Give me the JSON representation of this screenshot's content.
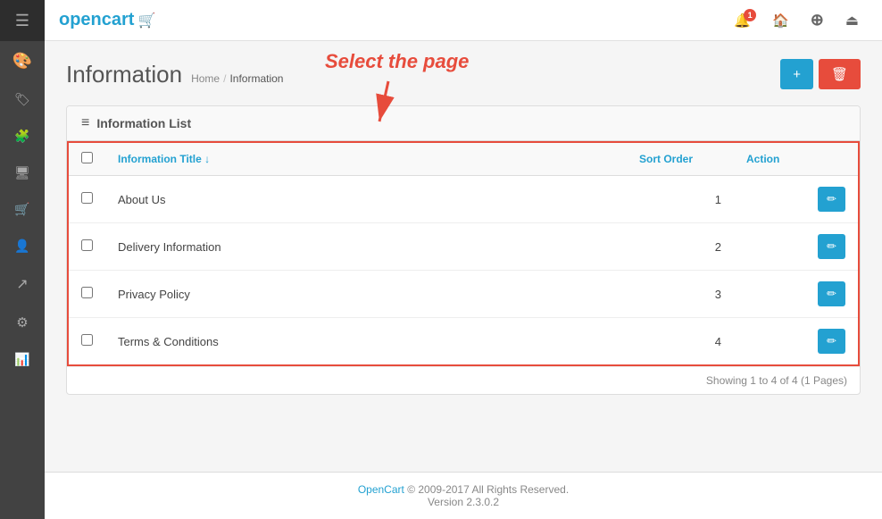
{
  "sidebar": {
    "icons": [
      {
        "name": "menu-icon",
        "symbol": "☰",
        "active": false
      },
      {
        "name": "palette-icon",
        "symbol": "🎨",
        "active": false
      },
      {
        "name": "tag-icon",
        "symbol": "🏷",
        "active": false
      },
      {
        "name": "puzzle-icon",
        "symbol": "🧩",
        "active": false
      },
      {
        "name": "monitor-icon",
        "symbol": "🖥",
        "active": false
      },
      {
        "name": "cart-icon",
        "symbol": "🛒",
        "active": false
      },
      {
        "name": "people-icon",
        "symbol": "👤",
        "active": false
      },
      {
        "name": "share-icon",
        "symbol": "↗",
        "active": false
      },
      {
        "name": "gear-icon",
        "symbol": "⚙",
        "active": false
      },
      {
        "name": "chart-icon",
        "symbol": "📊",
        "active": false
      }
    ]
  },
  "topbar": {
    "logo_text": "opencart",
    "notification_count": "1",
    "buttons": [
      {
        "name": "notification-btn",
        "symbol": "🔔"
      },
      {
        "name": "home-btn",
        "symbol": "🏠"
      },
      {
        "name": "help-btn",
        "symbol": "⊕"
      },
      {
        "name": "logout-btn",
        "symbol": "⏏"
      }
    ]
  },
  "page": {
    "title": "Information",
    "breadcrumb": {
      "home": "Home",
      "separator": "/",
      "current": "Information"
    },
    "annotation": "Select the page",
    "add_btn": "+",
    "delete_btn": "🗑"
  },
  "card": {
    "header_icon": "≡",
    "header_title": "Information List"
  },
  "table": {
    "headers": {
      "checkbox": "",
      "title": "Information Title ↓",
      "sort_order": "Sort Order",
      "action": "Action"
    },
    "rows": [
      {
        "id": 1,
        "title": "About Us",
        "sort_order": "1"
      },
      {
        "id": 2,
        "title": "Delivery Information",
        "sort_order": "2"
      },
      {
        "id": 3,
        "title": "Privacy Policy",
        "sort_order": "3"
      },
      {
        "id": 4,
        "title": "Terms & Conditions",
        "sort_order": "4"
      }
    ],
    "pagination": "Showing 1 to 4 of 4 (1 Pages)"
  },
  "footer": {
    "brand": "OpenCart",
    "copyright": "© 2009-2017 All Rights Reserved.",
    "version": "Version 2.3.0.2"
  }
}
